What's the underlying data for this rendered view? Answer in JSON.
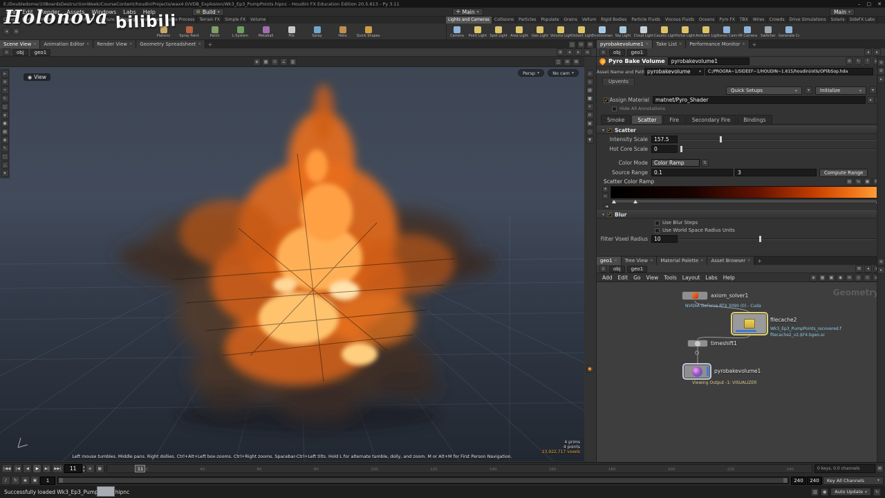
{
  "icons": {
    "close": "✕",
    "home": "⌂",
    "chevron": "▾"
  },
  "titlebar": {
    "title": "E:/Doubledome/10BoardsDestructionWeek/CourseContent/houdiniProjects/wax4.0/VDB_Explosion/Wk3_Ep3_PumpPoints.hipnc - Houdini FX Education Edition 20.5.613 - Py 3.11"
  },
  "watermark": {
    "brand": "Holonova",
    "platform": "bilibili"
  },
  "menubar": {
    "items": [
      "File",
      "Edit",
      "Render",
      "Assets",
      "Windows",
      "Labs",
      "Help"
    ],
    "build": "Build",
    "main": "Main"
  },
  "shelf": {
    "left_tabs": [
      "Create",
      "Modify",
      "Model",
      "Polygon",
      "Deform",
      "Texture",
      "Rigging",
      "Character",
      "Guide Process",
      "Terrain FX",
      "Simple FX",
      "Volume"
    ],
    "right_tabs": [
      "Lights and Cameras",
      "Collisions",
      "Particles",
      "Populate",
      "Grains",
      "Vellum",
      "Rigid Bodies",
      "Particle Fluids",
      "Viscous Fluids",
      "Oceans",
      "Pyro FX",
      "TBX",
      "Wires",
      "Crowds",
      "Drive Simulations",
      "Solaris",
      "SideFX Labs"
    ],
    "left_tools": [
      {
        "label": "Platonic",
        "c": "#c9a96a"
      },
      {
        "label": "Spray Paint",
        "c": "#b7613f"
      },
      {
        "label": "Patch",
        "c": "#7f9f67"
      },
      {
        "label": "L-System",
        "c": "#6f9f5f"
      },
      {
        "label": "Metaball",
        "c": "#9f6fae"
      },
      {
        "label": "File",
        "c": "#c9c9c9"
      },
      {
        "label": "Spray",
        "c": "#6fa7c9"
      },
      {
        "label": "Helix",
        "c": "#bf8f4f"
      },
      {
        "label": "Quick Shapes",
        "c": "#cf9f3f"
      }
    ],
    "right_tools": [
      {
        "label": "Camera",
        "c": "#8fb3d9"
      },
      {
        "label": "Point Light",
        "c": "#ddc36a"
      },
      {
        "label": "Spot Light",
        "c": "#ddc36a"
      },
      {
        "label": "Area Light",
        "c": "#ddc36a"
      },
      {
        "label": "Geo Light",
        "c": "#ddc36a"
      },
      {
        "label": "Volume Light",
        "c": "#ddc36a"
      },
      {
        "label": "Distant Light",
        "c": "#ddc36a"
      },
      {
        "label": "Environment Light",
        "c": "#a9c9e2"
      },
      {
        "label": "Sky Light",
        "c": "#a9c9e2"
      },
      {
        "label": "Cloud Light",
        "c": "#c9d2da"
      },
      {
        "label": "Caustic Light",
        "c": "#ddc36a"
      },
      {
        "label": "Portal Light",
        "c": "#ddc36a"
      },
      {
        "label": "Ambient Light",
        "c": "#ddc36a"
      },
      {
        "label": "Stereo Camera",
        "c": "#8fb3d9"
      },
      {
        "label": "VR Camera",
        "c": "#8fb3d9"
      },
      {
        "label": "Switcher",
        "c": "#9fa7ae"
      },
      {
        "label": "Generate Camera",
        "c": "#8fb3d9"
      }
    ]
  },
  "left_pane": {
    "tabs": [
      "Scene View",
      "Animation Editor",
      "Render View",
      "Geometry Spreadsheet"
    ],
    "path": [
      "obj",
      "geo1"
    ]
  },
  "viewport": {
    "view_badge": "View",
    "persp": "Persp",
    "cam": "No cam",
    "help": "Left mouse tumbles. Middle pans. Right dollies. Ctrl+Alt+Left box-zooms. Ctrl+Right zooms. Spacebar-Ctrl+Left tilts. Hold L for alternate tumble, dolly, and zoom. M or Alt+M for First Person Navigation.",
    "prims": "4 prims",
    "points": "4 points",
    "voxels": "23,922,717 voxels"
  },
  "params": {
    "pane_tabs": [
      "pyrobakevolume1",
      "Take List",
      "Performance Monitor"
    ],
    "path": [
      "obj",
      "geo1"
    ],
    "header_type": "Pyro Bake Volume",
    "header_name": "pyrobakevolume1",
    "asset_label": "Asset Name and Path",
    "asset_name": "pyrobakevolume",
    "asset_path": "C:/PROGRA~1/SIDEEF~1/HOUDIN~1.615/houdini/otls/OPlibSop.hda",
    "folder_tab": "Upvents",
    "quick_setups": "Quick Setups",
    "initialize": "Initialize",
    "assign_material": "Assign Material",
    "material_path": "matnet/Pyro_Shader",
    "annotation": "Hide All Annotations",
    "tabs": [
      "Smoke",
      "Scatter",
      "Fire",
      "Secondary Fire",
      "Bindings"
    ],
    "scatter": {
      "title": "Scatter",
      "intensity_label": "Intensity Scale",
      "intensity": "157.5",
      "hotcore_label": "Hot Core Scale",
      "hotcore": "0",
      "colormode_label": "Color Mode",
      "colormode": "Color Ramp",
      "source_label": "Source Range",
      "source_min": "0.1",
      "source_max": "3",
      "compute": "Compute Range",
      "ramp_label": "Scatter Color Ramp",
      "ramp_stops": [
        {
          "p": 0,
          "c": "#000000"
        },
        {
          "p": 30,
          "c": "#180300"
        },
        {
          "p": 55,
          "c": "#661300"
        },
        {
          "p": 75,
          "c": "#c23c00"
        },
        {
          "p": 90,
          "c": "#f07417"
        },
        {
          "p": 100,
          "c": "#ffa23e"
        }
      ]
    },
    "blur": {
      "title": "Blur",
      "steps": "Use Blur Steps",
      "world": "Use World Space Radius Units",
      "radius_label": "Filter Voxel Radius",
      "radius": "10"
    }
  },
  "network": {
    "pane_tabs": [
      "geo1",
      "Tree View",
      "Material Palette",
      "Asset Browser"
    ],
    "path": [
      "obj",
      "geo1"
    ],
    "menus": [
      "Add",
      "Edit",
      "Go",
      "View",
      "Tools",
      "Layout",
      "Labs",
      "Help"
    ],
    "watermark": "Geometry",
    "nodes": {
      "axiom": {
        "name": "axiom_solver1",
        "note": "NVIDIA GeForce RTX 3090 (0) - Cuda"
      },
      "filecache": {
        "name": "filecache2",
        "note1": "Wk3_Ep3_PumpPoints_recovered.f",
        "note2": "filecache2_v2.$F4.bgeo.sc"
      },
      "timeshift": {
        "name": "timeshift1"
      },
      "pyrobake": {
        "name": "pyrobakevolume1",
        "note": "Viewing Output -1: VISUALIZER"
      }
    }
  },
  "playbar": {
    "frame": "11",
    "ticks": [
      "20",
      "40",
      "60",
      "80",
      "100",
      "120",
      "140",
      "160",
      "180",
      "200",
      "220",
      "240"
    ],
    "start": "1",
    "end": "240",
    "end2": "240",
    "keys_info": "0 keys, 0.0 channels",
    "key_all": "Key All Channels"
  },
  "statusbar": {
    "message": "Successfully loaded Wk3_Ep3_PumpPoints.hipnc",
    "auto_update": "Auto Update"
  }
}
